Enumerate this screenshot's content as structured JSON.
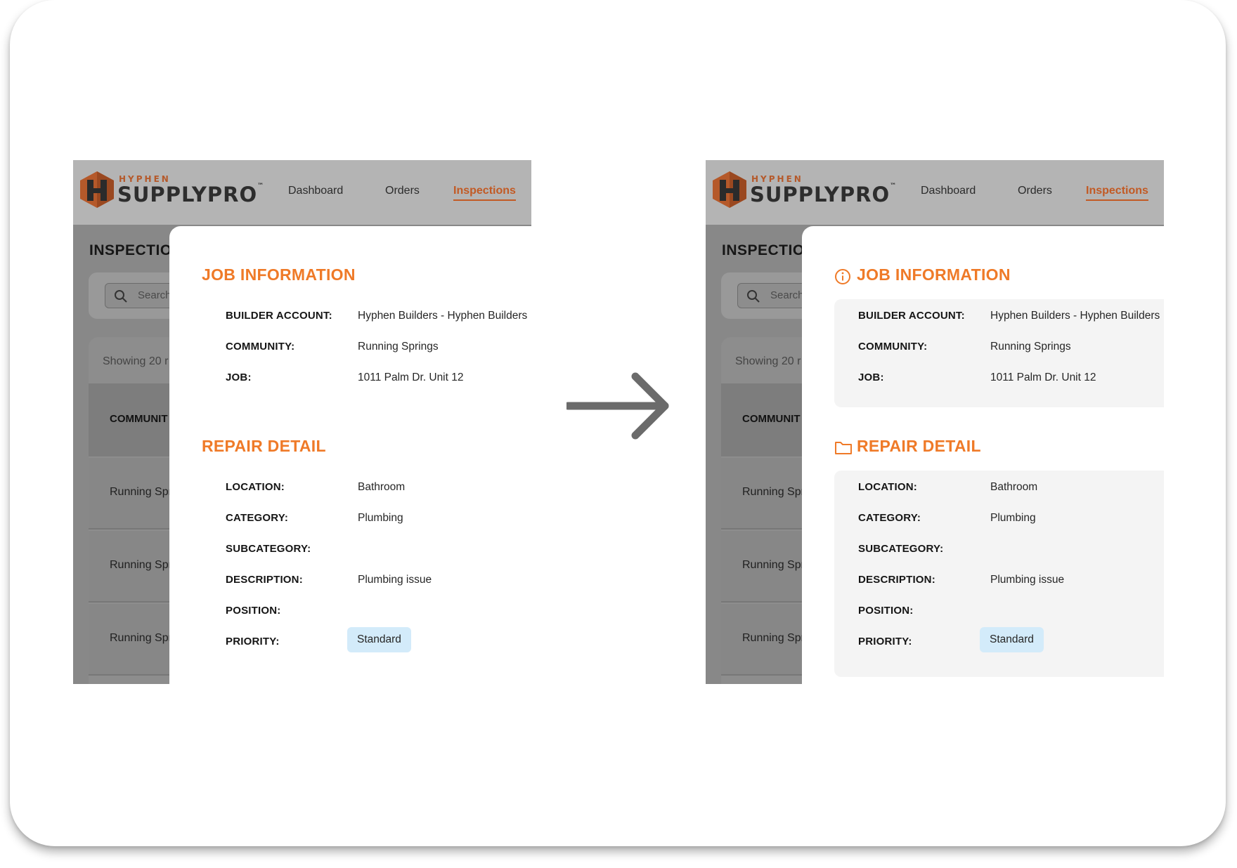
{
  "app": {
    "logo_small": "HYPHEN",
    "logo_big": "SUPPLYPRO",
    "logo_tm": "™",
    "nav": [
      "Dashboard",
      "Orders",
      "Inspections"
    ],
    "active_nav": "Inspections"
  },
  "background": {
    "page_title": "INSPECTIO",
    "search_placeholder": "Search",
    "showing_text": "Showing 20 r",
    "column_header": "COMMUNIT",
    "rows": [
      "Running Spr",
      "Running Spr",
      "Running Spr"
    ]
  },
  "job_information": {
    "title": "JOB INFORMATION",
    "icon": "info-icon",
    "fields": [
      {
        "label": "BUILDER ACCOUNT:",
        "value": "Hyphen Builders - Hyphen Builders"
      },
      {
        "label": "COMMUNITY:",
        "value": "Running Springs"
      },
      {
        "label": "JOB:",
        "value": "1011 Palm Dr. Unit 12"
      }
    ]
  },
  "repair_detail": {
    "title": "REPAIR DETAIL",
    "icon": "folder-icon",
    "fields": [
      {
        "label": "LOCATION:",
        "value": "Bathroom"
      },
      {
        "label": "CATEGORY:",
        "value": "Plumbing"
      },
      {
        "label": "SUBCATEGORY:",
        "value": ""
      },
      {
        "label": "DESCRIPTION:",
        "value": "Plumbing issue"
      },
      {
        "label": "POSITION:",
        "value": ""
      },
      {
        "label": "PRIORITY:",
        "value": "Standard"
      }
    ]
  },
  "colors": {
    "accent_orange": "#ef7a28",
    "nav_active": "#c25a24",
    "priority_badge": "#d3ebfa",
    "section_bg": "#f4f4f4"
  }
}
